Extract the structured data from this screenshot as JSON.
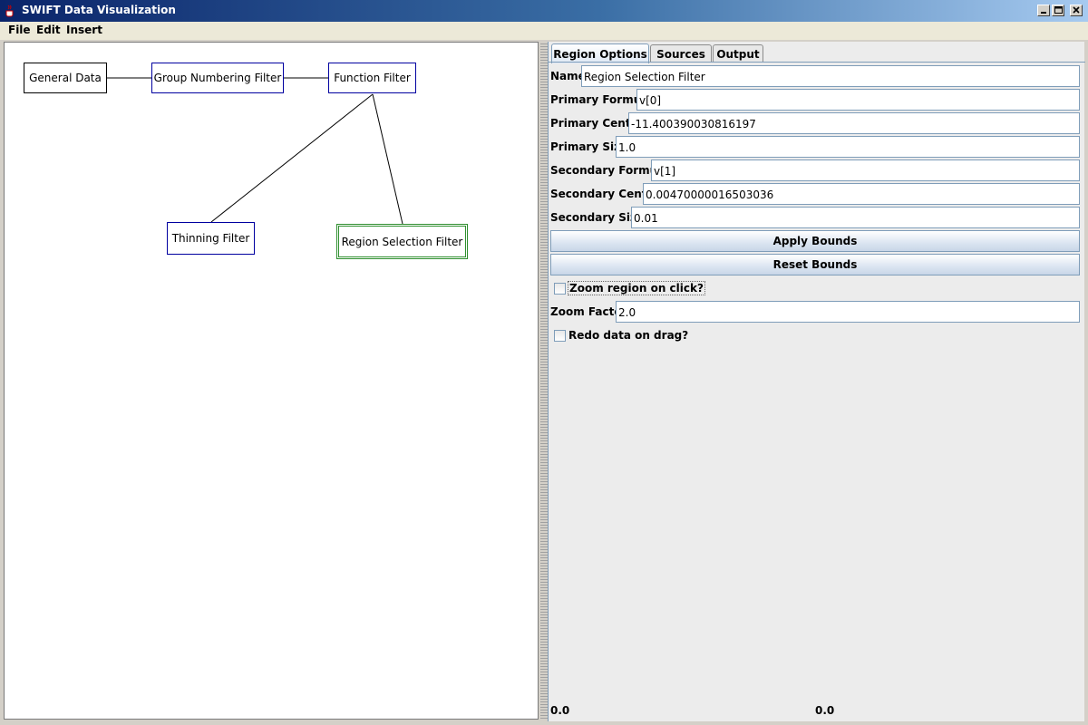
{
  "window": {
    "title": "SWIFT Data Visualization",
    "icon": "java-cup-icon"
  },
  "menubar": {
    "items": [
      "File",
      "Edit",
      "Insert"
    ]
  },
  "graph": {
    "nodes": [
      {
        "label": "General Data"
      },
      {
        "label": "Group Numbering Filter"
      },
      {
        "label": "Function Filter"
      },
      {
        "label": "Thinning Filter"
      },
      {
        "label": "Region Selection Filter",
        "selected": true
      }
    ]
  },
  "side": {
    "tabs": [
      {
        "label": "Region Options",
        "active": true
      },
      {
        "label": "Sources"
      },
      {
        "label": "Output"
      }
    ],
    "fields": [
      {
        "label": "Name",
        "value": "Region Selection Filter"
      },
      {
        "label": "Primary Formula",
        "value": "v[0]"
      },
      {
        "label": "Primary Center",
        "value": "-11.400390030816197"
      },
      {
        "label": "Primary Size",
        "value": "1.0"
      },
      {
        "label": "Secondary Formula",
        "value": "v[1]"
      },
      {
        "label": "Secondary Center",
        "value": "0.00470000016503036"
      },
      {
        "label": "Secondary Size",
        "value": "0.01"
      }
    ],
    "apply_bounds": "Apply Bounds",
    "reset_bounds": "Reset Bounds",
    "zoom_on_click": {
      "label": "Zoom region on click?",
      "checked": false
    },
    "zoom_factor": {
      "label": "Zoom Factor",
      "value": "2.0"
    },
    "redo_on_drag": {
      "label": "Redo data on drag?",
      "checked": false
    },
    "coords": [
      "0.0",
      "0.0"
    ]
  },
  "colors": {
    "selected_border": "#2f8f2f",
    "node_border": "#0000a0",
    "title_gradient_start": "#0a246a"
  }
}
